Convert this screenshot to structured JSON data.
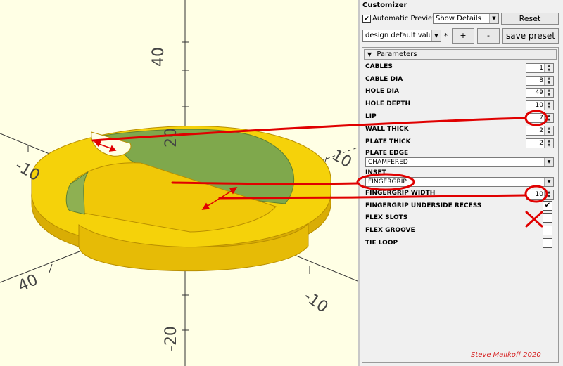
{
  "viewport": {
    "axis_labels": [
      {
        "id": "y-top",
        "text": "40"
      },
      {
        "id": "y-mid",
        "text": "20"
      },
      {
        "id": "x-left",
        "text": "-10"
      },
      {
        "id": "x-right",
        "text": "10"
      },
      {
        "id": "bottom-left",
        "text": "40"
      },
      {
        "id": "bottom-right",
        "text": "-10"
      },
      {
        "id": "z-bottom",
        "text": "-20"
      }
    ],
    "colors": {
      "background": "#ffffe5",
      "model": "#f5d20a",
      "model_dark": "#d9ad05",
      "model_edge": "#b98f00",
      "cut": "#7fa84c",
      "axis": "#333333"
    }
  },
  "customizer": {
    "title": "Customizer",
    "automatic_preview_label": "Automatic Preview",
    "automatic_preview_checked": "✔",
    "details_select": "Show Details",
    "reset_button": "Reset",
    "preset_select": "design default values",
    "modified_marker": "*",
    "add_button": "+",
    "remove_button": "-",
    "save_button": "save preset",
    "group_toggle": "▼",
    "group_title": "Parameters",
    "params": [
      {
        "id": "cables",
        "label": "CABLES",
        "type": "spin",
        "value": "1"
      },
      {
        "id": "cable-dia",
        "label": "CABLE DIA",
        "type": "spin",
        "value": "8"
      },
      {
        "id": "hole-dia",
        "label": "HOLE DIA",
        "type": "spin",
        "value": "49"
      },
      {
        "id": "hole-depth",
        "label": "HOLE DEPTH",
        "type": "spin",
        "value": "10"
      },
      {
        "id": "lip",
        "label": "LIP",
        "type": "spin",
        "value": "7"
      },
      {
        "id": "wall-thick",
        "label": "WALL THICK",
        "type": "spin",
        "value": "2"
      },
      {
        "id": "plate-thick",
        "label": "PLATE THICK",
        "type": "spin",
        "value": "2"
      },
      {
        "id": "plate-edge",
        "label": "PLATE EDGE",
        "type": "select",
        "value": "CHAMFERED"
      },
      {
        "id": "inset",
        "label": "INSET",
        "type": "select",
        "value": "FINGERGRIP"
      },
      {
        "id": "fingergrip-width",
        "label": "FINGERGRIP WIDTH",
        "type": "spin",
        "value": "10"
      },
      {
        "id": "fingergrip-underside-recess",
        "label": "FINGERGRIP UNDERSIDE RECESS",
        "type": "check",
        "value": "✔"
      },
      {
        "id": "flex-slots",
        "label": "FLEX SLOTS",
        "type": "check",
        "value": ""
      },
      {
        "id": "flex-groove",
        "label": "FLEX GROOVE",
        "type": "check",
        "value": ""
      },
      {
        "id": "tie-loop",
        "label": "TIE LOOP",
        "type": "check",
        "value": ""
      }
    ]
  },
  "annotation_color": "#e00000",
  "credit": "Steve Malikoff   2020"
}
